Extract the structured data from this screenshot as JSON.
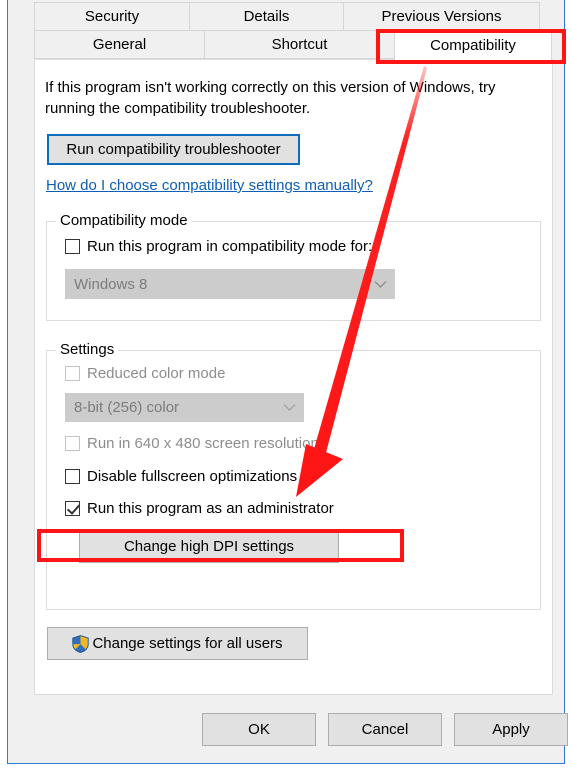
{
  "window": {
    "accent_border_color": "#2a7fd4",
    "body_background": "#f0f0f0"
  },
  "tabs": {
    "row1": [
      {
        "label": "Security",
        "selected": false
      },
      {
        "label": "Details",
        "selected": false
      },
      {
        "label": "Previous Versions",
        "selected": false
      }
    ],
    "row2": [
      {
        "label": "General",
        "selected": false
      },
      {
        "label": "Shortcut",
        "selected": false
      },
      {
        "label": "Compatibility",
        "selected": true
      }
    ]
  },
  "page": {
    "intro_text": "If this program isn't working correctly on this version of Windows, try running the compatibility troubleshooter.",
    "troubleshoot_button": "Run compatibility troubleshooter",
    "help_link": "How do I choose compatibility settings manually?"
  },
  "compatibility_mode": {
    "legend": "Compatibility mode",
    "checkbox_label": "Run this program in compatibility mode for:",
    "checkbox_checked": false,
    "os_select_value": "Windows 8",
    "os_select_disabled": true,
    "os_select_options": [
      "Windows 8"
    ]
  },
  "settings": {
    "legend": "Settings",
    "items": [
      {
        "label": "Reduced color mode",
        "checked": false,
        "disabled": true
      },
      {
        "label": "Run in 640 x 480 screen resolution",
        "checked": false,
        "disabled": true
      },
      {
        "label": "Disable fullscreen optimizations",
        "checked": false,
        "disabled": false
      },
      {
        "label": "Run this program as an administrator",
        "checked": true,
        "disabled": false
      }
    ],
    "color_select_value": "8-bit (256) color",
    "color_select_disabled": true,
    "color_select_options": [
      "8-bit (256) color"
    ],
    "dpi_button": "Change high DPI settings"
  },
  "all_users": {
    "button_label": "Change settings for all users",
    "shield_icon": "uac-shield-icon",
    "shield_blue": "#2f6fbd",
    "shield_gold": "#f2b824"
  },
  "dialog_buttons": {
    "ok": "OK",
    "cancel": "Cancel",
    "apply": "Apply"
  },
  "annotations": {
    "highlight_color": "#fe1616",
    "tab_highlight_target": "Compatibility",
    "checkbox_highlight_target": "Run this program as an administrator",
    "arrow_from": "Compatibility tab",
    "arrow_to": "Disable fullscreen optimizations / admin checkbox area"
  }
}
